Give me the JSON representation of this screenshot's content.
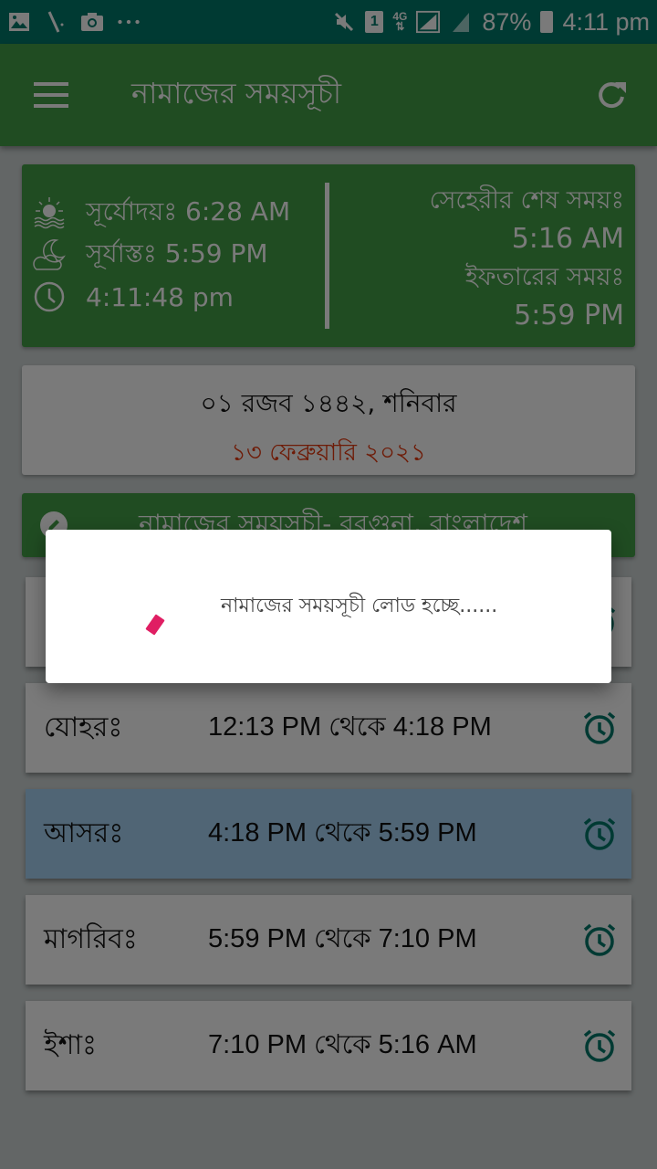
{
  "status_bar": {
    "left_icons": [
      "gallery-icon",
      "stylus-icon",
      "camera-icon",
      "more-dots-icon"
    ],
    "right_icons": [
      "mute-icon",
      "sim-1-icon",
      "4g-icon",
      "signal-icon",
      "signal-2-icon",
      "battery-charging-icon"
    ],
    "sim_label": "1",
    "network_label": "4G",
    "battery": "87%",
    "time": "4:11 pm"
  },
  "app_bar": {
    "title": "নামাজের সময়সূচী",
    "menu_icon": "hamburger-menu-icon",
    "refresh_icon": "refresh-icon"
  },
  "sun_card": {
    "sunrise": "সূর্যোদয়ঃ 6:28 AM",
    "sunset": "সূর্যাস্তঃ 5:59 PM",
    "current_time": "4:11:48 pm",
    "sehri_label": "সেহেরীর শেষ সময়ঃ",
    "sehri_time": "5:16 AM",
    "iftar_label": "ইফতারের সময়ঃ",
    "iftar_time": "5:59 PM"
  },
  "date_card": {
    "hijri": "০১ রজব ১৪৪২, শনিবার",
    "gregorian": "১৩ ফেব্রুয়ারি ২০২১"
  },
  "location": {
    "title": "নামাজের সময়সূচী- বরগুনা, বাংলাদেশ"
  },
  "prayers": [
    {
      "name": "যোহরঃ",
      "time": "12:13 PM থেকে 4:18 PM",
      "active": false
    },
    {
      "name": "আসরঃ",
      "time": "4:18 PM থেকে 5:59 PM",
      "active": true
    },
    {
      "name": "মাগরিবঃ",
      "time": "5:59 PM থেকে 7:10 PM",
      "active": false
    },
    {
      "name": "ইশাঃ",
      "time": "7:10 PM থেকে 5:16 AM",
      "active": false
    }
  ],
  "dialog": {
    "message": "নামাজের সময়সূচী লোড হচ্ছে......"
  },
  "colors": {
    "primary_green": "#43a047",
    "status_bar": "#00796b",
    "active_row": "#a7d4f4",
    "alarm_icon": "#00796b",
    "gregorian_date": "#e53a10",
    "spinner": "#e01e63"
  }
}
